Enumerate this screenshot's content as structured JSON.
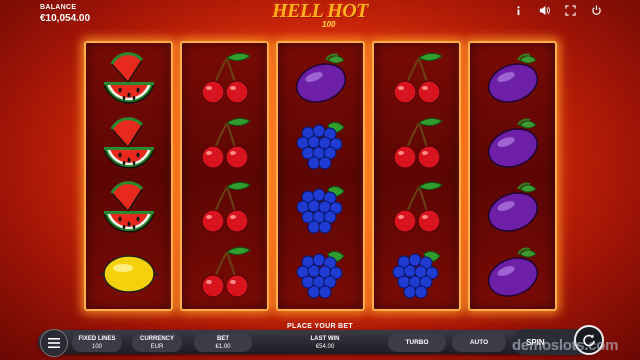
{
  "balance": {
    "label": "BALANCE",
    "value": "€10,054.00"
  },
  "logo": {
    "title": "HELL HOT",
    "subtitle": "100"
  },
  "top_icons": [
    "info-icon",
    "sound-icon",
    "fullscreen-icon",
    "power-icon"
  ],
  "reels": [
    [
      "watermelon",
      "watermelon",
      "watermelon",
      "lemon"
    ],
    [
      "cherry",
      "cherry",
      "cherry",
      "cherry"
    ],
    [
      "plum",
      "grapes",
      "grapes",
      "grapes"
    ],
    [
      "cherry",
      "cherry",
      "cherry",
      "grapes"
    ],
    [
      "plum",
      "plum",
      "plum",
      "plum"
    ]
  ],
  "bottom": {
    "place_bet": "PLACE YOUR BET",
    "fixed_lines_label": "FIXED LINES",
    "fixed_lines_value": "100",
    "currency_label": "CURRENCY",
    "currency_value": "EUR",
    "bet_label": "BET",
    "bet_value": "€1.00",
    "last_win_label": "LAST WIN",
    "last_win_value": "€54.00",
    "turbo_label": "TURBO",
    "auto_label": "AUTO",
    "spin_label": "SPIN"
  },
  "watermark": "demoslots.com",
  "colors": {
    "accent": "#ffb04a",
    "background": "#e0300a",
    "reel_bg": "#5c0603"
  }
}
